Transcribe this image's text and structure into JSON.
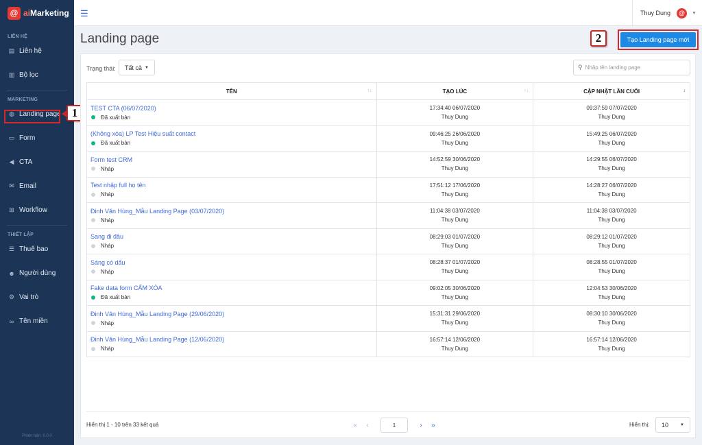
{
  "app": {
    "logo_letter": "@",
    "logo_prefix": "ai",
    "logo_suffix": "Marketing",
    "version": "Phiên bản: 0.0.0"
  },
  "sidebar": {
    "sections": [
      {
        "title": "LIÊN HỆ",
        "items": [
          {
            "label": "Liên hệ",
            "icon": "contact-book-icon"
          },
          {
            "label": "Bộ lọc",
            "icon": "filter-list-icon"
          }
        ]
      },
      {
        "title": "MARKETING",
        "items": [
          {
            "label": "Landing page",
            "icon": "globe-icon",
            "active": true
          },
          {
            "label": "Form",
            "icon": "form-icon"
          },
          {
            "label": "CTA",
            "icon": "megaphone-icon"
          },
          {
            "label": "Email",
            "icon": "envelope-icon"
          },
          {
            "label": "Workflow",
            "icon": "sitemap-icon"
          }
        ]
      },
      {
        "title": "THIẾT LẬP",
        "items": [
          {
            "label": "Thuê bao",
            "icon": "subscription-icon"
          },
          {
            "label": "Người dùng",
            "icon": "users-icon"
          },
          {
            "label": "Vai trò",
            "icon": "cogs-icon"
          },
          {
            "label": "Tên miền",
            "icon": "link-icon"
          }
        ]
      }
    ]
  },
  "topbar": {
    "user_name": "Thuy Dung"
  },
  "page": {
    "title": "Landing page",
    "create_button": "Tạo Landing page mới",
    "callout_1": "1",
    "callout_2": "2"
  },
  "filter": {
    "label": "Trạng thái:",
    "value": "Tất cả"
  },
  "search": {
    "placeholder": "Nhập tên landing page"
  },
  "table": {
    "columns": [
      "TÊN",
      "TẠO LÚC",
      "CẬP NHẬT LẦN CUỐI"
    ],
    "rows": [
      {
        "name": "TEST CTA (06/07/2020)",
        "status": "Đã xuất bản",
        "published": true,
        "created": "17:34:40 06/07/2020",
        "created_by": "Thuy Dung",
        "updated": "09:37:59 07/07/2020",
        "updated_by": "Thuy Dung"
      },
      {
        "name": "(Không xóa) LP Test Hiệu suất contact",
        "status": "Đã xuất bản",
        "published": true,
        "created": "09:46:25 26/06/2020",
        "created_by": "Thuy Dung",
        "updated": "15:49:25 06/07/2020",
        "updated_by": "Thuy Dung"
      },
      {
        "name": "Form test CRM",
        "status": "Nháp",
        "published": false,
        "created": "14:52:59 30/06/2020",
        "created_by": "Thuy Dung",
        "updated": "14:29:55 06/07/2020",
        "updated_by": "Thuy Dung"
      },
      {
        "name": "Test nhập full họ tên",
        "status": "Nháp",
        "published": false,
        "created": "17:51:12 17/06/2020",
        "created_by": "Thuy Dung",
        "updated": "14:28:27 06/07/2020",
        "updated_by": "Thuy Dung"
      },
      {
        "name": "Đinh Văn Hùng_Mẫu Landing Page (03/07/2020)",
        "status": "Nháp",
        "published": false,
        "created": "11:04:38 03/07/2020",
        "created_by": "Thuy Dung",
        "updated": "11:04:38 03/07/2020",
        "updated_by": "Thuy Dung"
      },
      {
        "name": "Sang đi đâu",
        "status": "Nháp",
        "published": false,
        "created": "08:29:03 01/07/2020",
        "created_by": "Thuy Dung",
        "updated": "08:29:12 01/07/2020",
        "updated_by": "Thuy Dung"
      },
      {
        "name": "Sáng có dấu",
        "status": "Nháp",
        "published": false,
        "created": "08:28:37 01/07/2020",
        "created_by": "Thuy Dung",
        "updated": "08:28:55 01/07/2020",
        "updated_by": "Thuy Dung"
      },
      {
        "name": "Fake data form CẤM XÓA",
        "status": "Đã xuất bản",
        "published": true,
        "created": "09:02:05 30/06/2020",
        "created_by": "Thuy Dung",
        "updated": "12:04:53 30/06/2020",
        "updated_by": "Thuy Dung"
      },
      {
        "name": "Đinh Văn Hùng_Mẫu Landing Page (29/06/2020)",
        "status": "Nháp",
        "published": false,
        "created": "15:31:31 29/06/2020",
        "created_by": "Thuy Dung",
        "updated": "08:30:10 30/06/2020",
        "updated_by": "Thuy Dung"
      },
      {
        "name": "Đinh Văn Hùng_Mẫu Landing Page (12/06/2020)",
        "status": "Nháp",
        "published": false,
        "created": "16:57:14 12/06/2020",
        "created_by": "Thuy Dung",
        "updated": "16:57:14 12/06/2020",
        "updated_by": "Thuy Dung"
      }
    ]
  },
  "footer": {
    "result_text": "Hiển thị 1 - 10 trên 33 kết quả",
    "current_page": "1",
    "per_page_label": "Hiển thị:",
    "per_page_value": "10"
  },
  "colors": {
    "sidebar_bg": "#1c3557",
    "primary": "#1e88e5",
    "link": "#3f6ad8",
    "published_dot": "#12b58a",
    "callout_red": "#d62828"
  }
}
